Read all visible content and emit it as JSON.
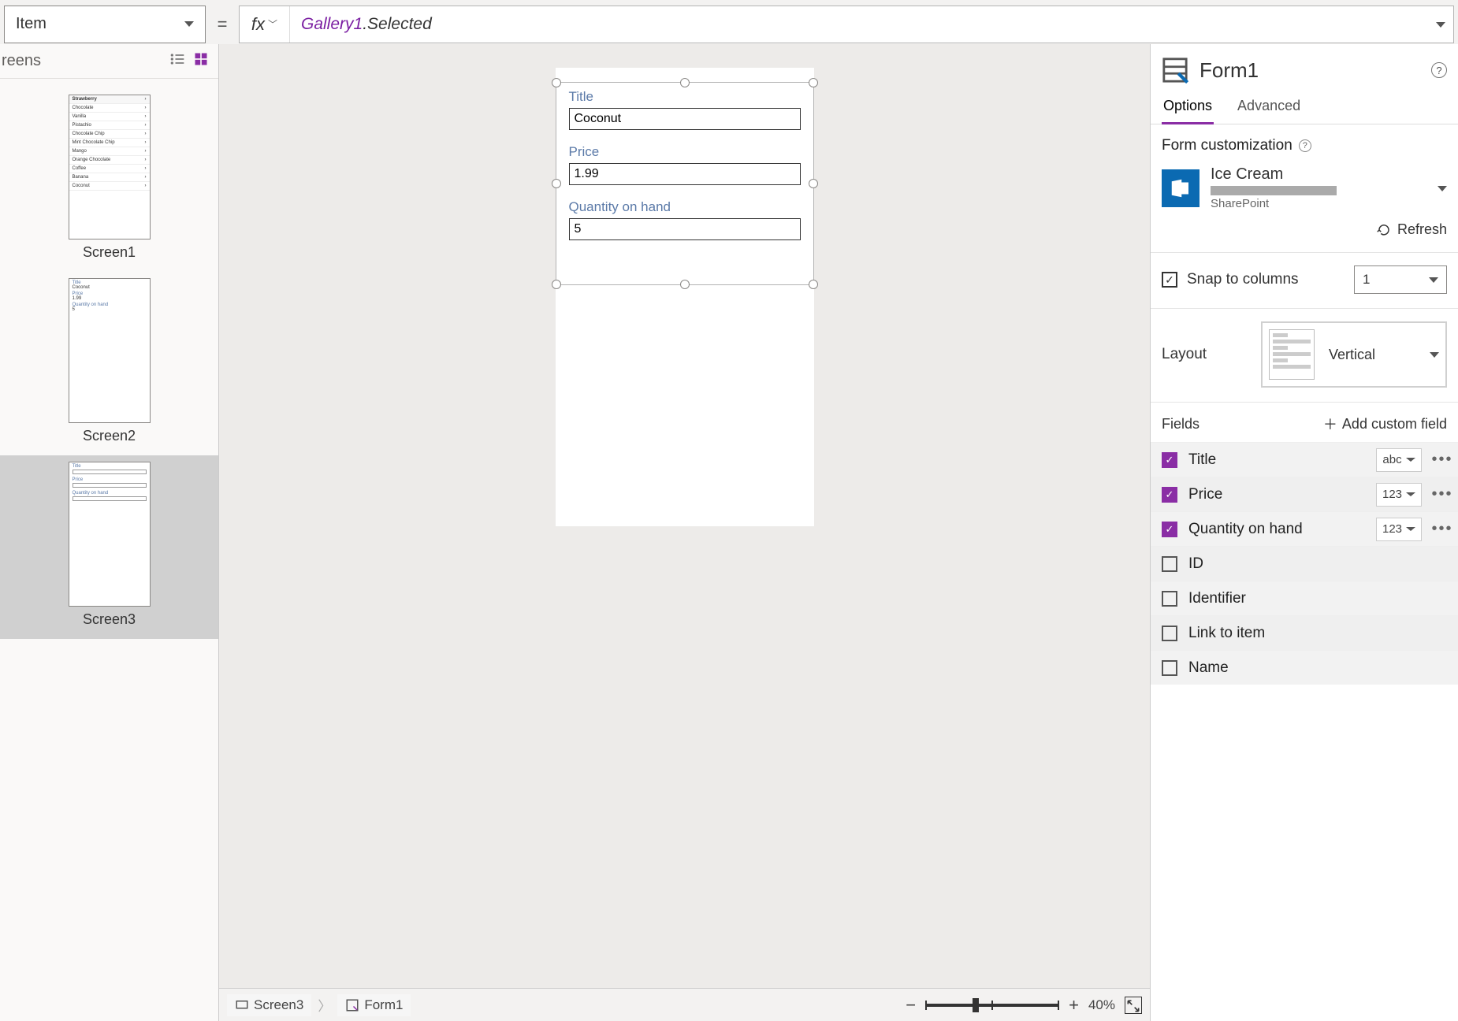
{
  "formula": {
    "property": "Item",
    "fx": "fx",
    "object": "Gallery1",
    "suffix": ".Selected"
  },
  "leftPane": {
    "title": "reens",
    "screens": [
      {
        "name": "Screen1",
        "selected": false
      },
      {
        "name": "Screen2",
        "selected": false
      },
      {
        "name": "Screen3",
        "selected": true
      }
    ],
    "thumb1_rows": [
      "Strawberry",
      "Chocolate",
      "Vanilla",
      "Pistachio",
      "Chocolate Chip",
      "Mint Chocolate Chip",
      "Mango",
      "Orange Chocolate",
      "Coffee",
      "Banana",
      "Coconut"
    ],
    "thumb_form": {
      "f1": "Title",
      "v1": "Coconut",
      "f2": "Price",
      "v2": "1.99",
      "f3": "Quantity on hand",
      "v3": "5"
    }
  },
  "canvas": {
    "fields": [
      {
        "label": "Title",
        "value": "Coconut"
      },
      {
        "label": "Price",
        "value": "1.99"
      },
      {
        "label": "Quantity on hand",
        "value": "5"
      }
    ]
  },
  "status": {
    "crumb1": "Screen3",
    "crumb2": "Form1",
    "zoom": "40%"
  },
  "right": {
    "title": "Form1",
    "tabs": {
      "options": "Options",
      "advanced": "Advanced"
    },
    "formCustom": "Form customization",
    "dataSource": {
      "name": "Ice Cream",
      "provider": "SharePoint"
    },
    "refresh": "Refresh",
    "snap": {
      "label": "Snap to columns",
      "value": "1"
    },
    "layout": {
      "label": "Layout",
      "value": "Vertical"
    },
    "fieldsHd": "Fields",
    "addField": "Add custom field",
    "fields": [
      {
        "name": "Title",
        "checked": true,
        "type": "abc"
      },
      {
        "name": "Price",
        "checked": true,
        "type": "123"
      },
      {
        "name": "Quantity on hand",
        "checked": true,
        "type": "123"
      },
      {
        "name": "ID",
        "checked": false,
        "type": ""
      },
      {
        "name": "Identifier",
        "checked": false,
        "type": ""
      },
      {
        "name": "Link to item",
        "checked": false,
        "type": ""
      },
      {
        "name": "Name",
        "checked": false,
        "type": ""
      }
    ]
  }
}
